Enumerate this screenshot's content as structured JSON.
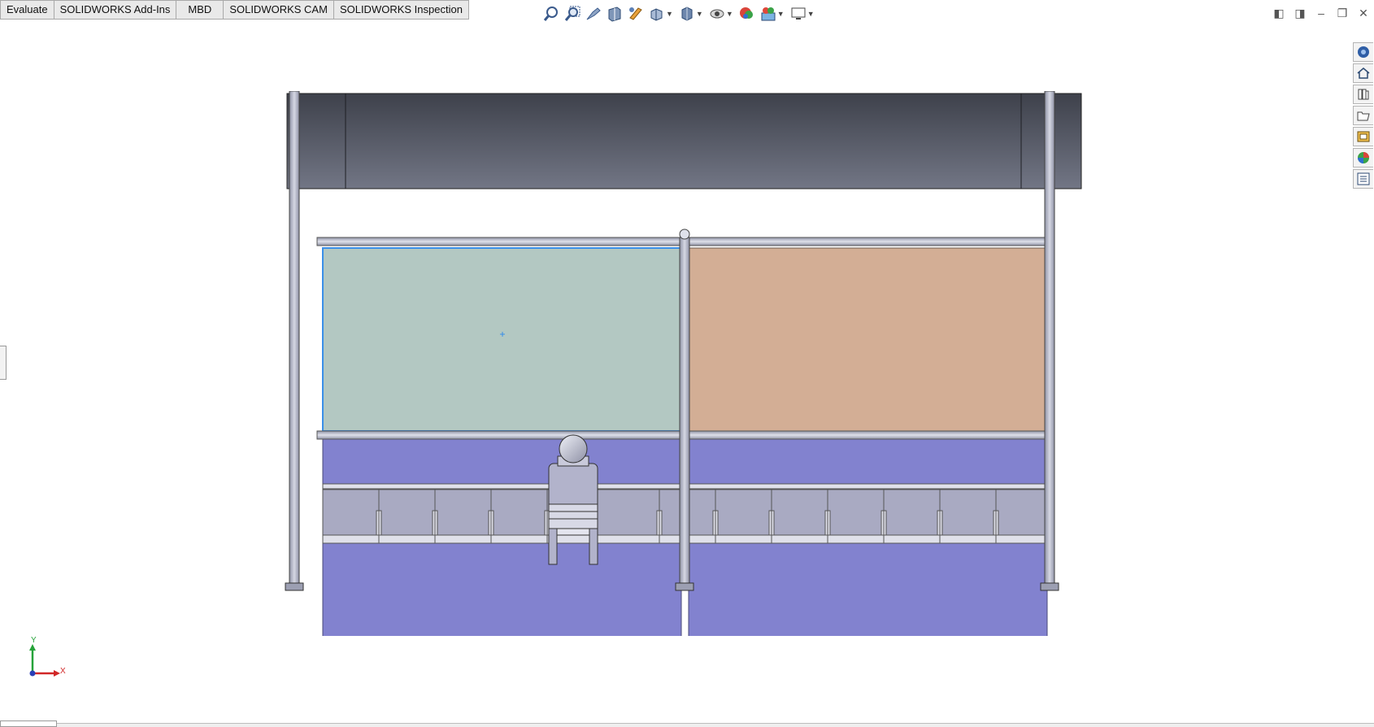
{
  "tabs": [
    "Evaluate",
    "SOLIDWORKS Add-Ins",
    "MBD",
    "SOLIDWORKS CAM",
    "SOLIDWORKS Inspection"
  ],
  "heads_up_toolbar": [
    {
      "icon": "zoom-to-fit-icon"
    },
    {
      "icon": "zoom-to-area-icon"
    },
    {
      "icon": "previous-view-icon"
    },
    {
      "icon": "section-view-icon"
    },
    {
      "icon": "dynamic-annotation-views-icon"
    },
    {
      "icon": "view-orientation-icon",
      "dropdown": true
    },
    {
      "icon": "display-style-icon",
      "dropdown": true
    },
    {
      "icon": "hide-show-items-icon",
      "dropdown": true
    },
    {
      "icon": "edit-appearance-icon"
    },
    {
      "icon": "apply-scene-icon",
      "dropdown": true
    },
    {
      "icon": "view-settings-icon",
      "dropdown": true
    }
  ],
  "window_controls": [
    "tile-left-icon",
    "tile-right-icon",
    "minimize-icon",
    "restore-icon"
  ],
  "task_pane": [
    "solidworks-resources-icon",
    "home-icon",
    "design-library-icon",
    "file-explorer-icon",
    "view-palette-icon",
    "appearances-scenes-icon",
    "custom-properties-icon"
  ],
  "triad": {
    "x_label": "X",
    "y_label": "Y"
  },
  "colors": {
    "glass_left": "#b3c8c2",
    "glass_right": "#d3ae95",
    "lower_panel": "#8282cf",
    "selection": "#3a8fe8",
    "frame": "#b6b8c6"
  }
}
